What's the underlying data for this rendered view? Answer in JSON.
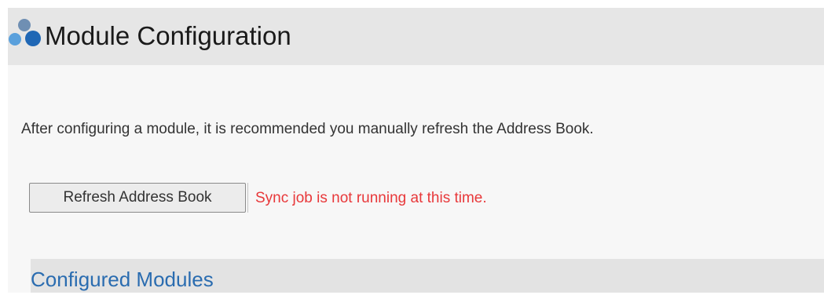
{
  "header": {
    "title": "Module Configuration",
    "icon": "modules-icon",
    "icon_colors": [
      "#6f8fb3",
      "#5aa0dc",
      "#1f67b5"
    ]
  },
  "main": {
    "intro_text": "After configuring a module, it is recommended you manually refresh the Address Book.",
    "refresh_button_label": "Refresh Address Book",
    "sync_status": "Sync job is not running at this time.",
    "sync_status_color": "#e8383a"
  },
  "section": {
    "heading": "Configured Modules",
    "heading_color": "#2a6cb0"
  }
}
